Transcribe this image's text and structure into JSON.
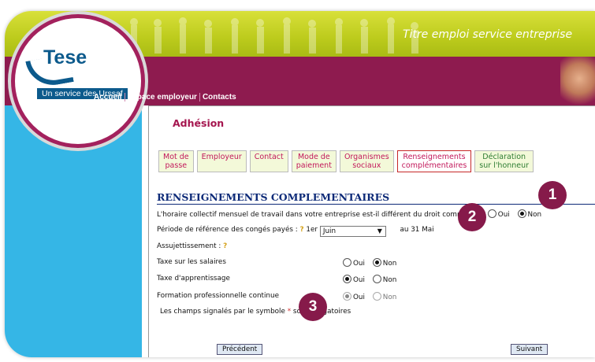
{
  "banner": {
    "title": "Titre emploi service entreprise",
    "logo_text": "Tese",
    "logo_subtitle": "Un service des Urssaf"
  },
  "nav": {
    "items": [
      "Accueil",
      "Espace employeur",
      "Contacts"
    ]
  },
  "page": {
    "title": "Adhésion"
  },
  "tabs": [
    {
      "label": "Mot de\npasse"
    },
    {
      "label": "Employeur"
    },
    {
      "label": "Contact"
    },
    {
      "label": "Mode de\npaiement"
    },
    {
      "label": "Organismes\nsociaux"
    },
    {
      "label": "Renseignements\ncomplémentaires"
    },
    {
      "label": "Déclaration\nsur l'honneur"
    }
  ],
  "section": {
    "title": "RENSEIGNEMENTS COMPLEMENTAIRES"
  },
  "form": {
    "horaire": {
      "label": "L'horaire collectif mensuel de travail dans votre entreprise est-il différent du droit commun ?",
      "oui": "Oui",
      "non": "Non",
      "selected": "Non"
    },
    "periode": {
      "label": "Période de référence des congés payés :",
      "prefix": "1er",
      "month": "Juin",
      "suffix": "au 31 Mai"
    },
    "assujettissement": {
      "label": "Assujettissement :"
    },
    "taxe_salaires": {
      "label": "Taxe sur les salaires",
      "oui": "Oui",
      "non": "Non",
      "selected": "Non"
    },
    "taxe_apprentissage": {
      "label": "Taxe d'apprentissage",
      "oui": "Oui",
      "non": "Non",
      "selected": "Oui"
    },
    "formation": {
      "label": "Formation professionnelle continue",
      "oui": "Oui",
      "non": "Non",
      "selected": "Oui",
      "disabled": true
    },
    "note_before": "Les champs signalés par le symbole",
    "note_star": "*",
    "note_after": "sont obligatoires"
  },
  "buttons": {
    "previous": "Précédent",
    "next": "Suivant"
  },
  "badges": [
    "1",
    "2",
    "3"
  ],
  "colors": {
    "brand_purple": "#8e1b4f",
    "sidebar_blue": "#35b6e6",
    "banner_green": "#bccb1c",
    "section_navy": "#0d2a78"
  }
}
